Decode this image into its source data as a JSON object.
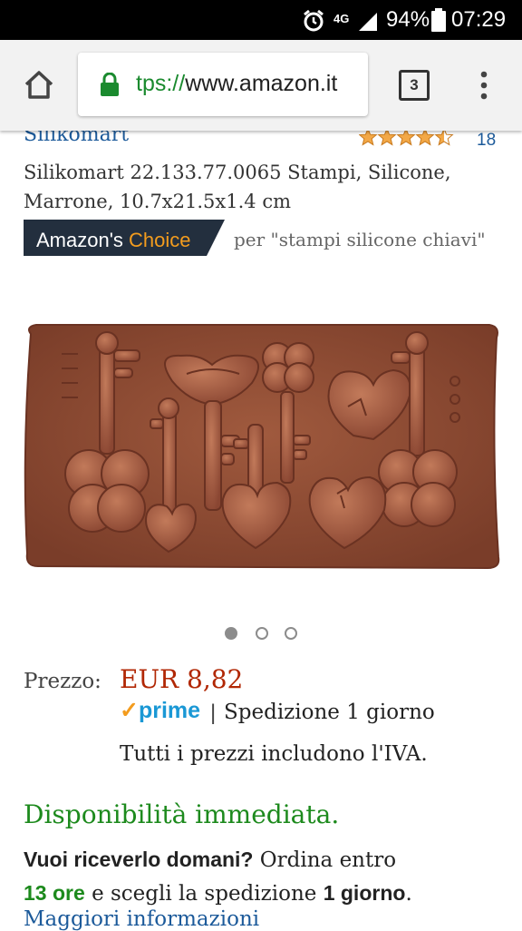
{
  "status_bar": {
    "network": "4G",
    "battery": "94%",
    "time": "07:29"
  },
  "browser": {
    "url_scheme": "tps://",
    "url_host": "www.amazon.it",
    "tab_count": "3"
  },
  "product": {
    "brand": "Silikomart",
    "rating_stars": 4.5,
    "review_count": "18",
    "title": "Silikomart 22.133.77.0065 Stampi, Silicone, Marrone, 10.7x21.5x1.4 cm",
    "choice_badge_part1": "Amazon's ",
    "choice_badge_part2": "Choice",
    "choice_query": "per \"stampi silicone chiavi\"",
    "image_count": 3,
    "active_image": 1
  },
  "price": {
    "label": "Prezzo:",
    "value": "EUR 8,82",
    "prime_logo": "prime",
    "separator": "|",
    "shipping": "Spedizione 1 giorno",
    "vat_note": "Tutti i prezzi includono l'IVA."
  },
  "availability": {
    "status": "Disponibilità immediata.",
    "question": "Vuoi riceverlo domani?",
    "order_within": "Ordina entro",
    "hours": "13 ore",
    "choose_text": "e scegli la spedizione",
    "one_day": "1 giorno",
    "period": ".",
    "more_info": "Maggiori informazioni"
  },
  "colors": {
    "mold": "#8e4a34",
    "mold_highlight": "#b8694c",
    "price": "#b12704",
    "availability": "#1d8a1d",
    "link": "#1c5a9a",
    "badge": "#232f3e",
    "badge_accent": "#f39c1e",
    "prime": "#1a98d5"
  }
}
